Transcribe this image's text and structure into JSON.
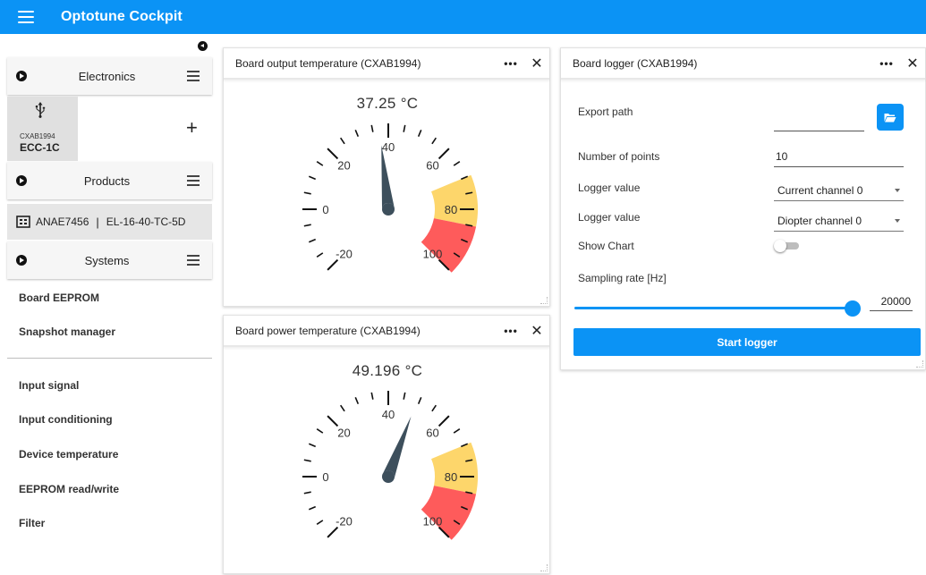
{
  "app": {
    "title": "Optotune Cockpit"
  },
  "sidebar": {
    "electronics_label": "Electronics",
    "device": {
      "subtitle": "CXAB1994",
      "name": "ECC-1C"
    },
    "add_label": "+",
    "products_label": "Products",
    "product": {
      "serial": "ANAE7456",
      "separator": "|",
      "model": "EL-16-40-TC-5D"
    },
    "systems_label": "Systems",
    "items_top": [
      "Board EEPROM",
      "Snapshot manager"
    ],
    "items_bottom": [
      "Input signal",
      "Input conditioning",
      "Device temperature",
      "EEPROM read/write",
      "Filter"
    ]
  },
  "gauge_output": {
    "title": "Board output temperature (CXAB1994)",
    "value_text": "37.25 °C",
    "value": 37.25,
    "min": -20,
    "max": 100,
    "tick_labels": [
      "-20",
      "0",
      "20",
      "40",
      "60",
      "80",
      "100"
    ],
    "warn_band": [
      70,
      85
    ],
    "danger_band": [
      85,
      100
    ],
    "warn_color": "#fdd66b",
    "danger_color": "#fe5b5b"
  },
  "gauge_power": {
    "title": "Board power temperature (CXAB1994)",
    "value_text": "49.196 °C",
    "value": 49.196,
    "min": -20,
    "max": 100,
    "tick_labels": [
      "-20",
      "0",
      "20",
      "40",
      "60",
      "80",
      "100"
    ],
    "warn_band": [
      70,
      85
    ],
    "danger_band": [
      85,
      100
    ],
    "warn_color": "#fdd66b",
    "danger_color": "#fe5b5b"
  },
  "panel_more": "•••",
  "panel_close": "✕",
  "logger": {
    "title": "Board logger (CXAB1994)",
    "export_label": "Export path",
    "export_value": "",
    "points_label": "Number of points",
    "points_value": "10",
    "value1_label": "Logger value",
    "value1_selected": "Current channel 0",
    "value2_label": "Logger value",
    "value2_selected": "Diopter channel 0",
    "chart_label": "Show Chart",
    "show_chart": false,
    "rate_label": "Sampling rate [Hz]",
    "rate_value": "20000",
    "rate_fraction": 1.0,
    "start_label": "Start logger"
  },
  "colors": {
    "accent": "#0b93f5"
  }
}
